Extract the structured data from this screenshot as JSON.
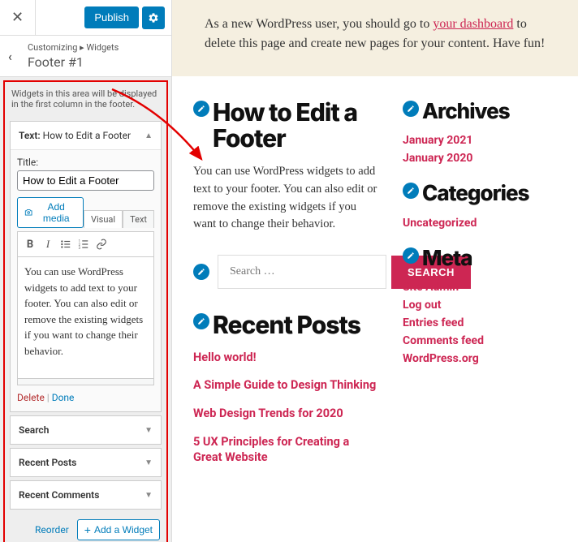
{
  "topbar": {
    "publish": "Publish"
  },
  "breadcrumb": "Customizing ▸ Widgets",
  "panel_title": "Footer #1",
  "panel_desc": "Widgets in this area will be displayed in the first column in the footer.",
  "widget_open": {
    "type_label": "Text:",
    "type_value": "How to Edit a Footer",
    "title_label": "Title:",
    "title_value": "How to Edit a Footer",
    "add_media": "Add media",
    "tabs": {
      "visual": "Visual",
      "text": "Text"
    },
    "content": "You can use WordPress widgets to add text to your footer. You can also edit or remove the existing widgets if you want to change their behavior.",
    "delete": "Delete",
    "done": "Done"
  },
  "widgets_collapsed": [
    "Search",
    "Recent Posts",
    "Recent Comments"
  ],
  "footer_links": {
    "reorder": "Reorder",
    "add_widget": "Add a Widget"
  },
  "preview": {
    "notice_pre": "As a new WordPress user, you should go to ",
    "notice_link": "your dashboard",
    "notice_post": " to delete this page and create new pages for your content. Have fun!",
    "main_title": "How to Edit a Footer",
    "main_text": "You can use WordPress widgets to add text to your footer. You can also edit or remove the existing widgets if you want to change their behavior.",
    "search_placeholder": "Search …",
    "search_btn": "SEARCH",
    "recent_posts_title": "Recent Posts",
    "recent_posts": [
      "Hello world!",
      "A Simple Guide to Design Thinking",
      "Web Design Trends for 2020",
      "5 UX Principles for Creating a Great Website"
    ],
    "archives_title": "Archives",
    "archives": [
      "January 2021",
      "January 2020"
    ],
    "categories_title": "Categories",
    "categories": [
      "Uncategorized"
    ],
    "meta_title": "Meta",
    "meta": [
      "Site Admin",
      "Log out",
      "Entries feed",
      "Comments feed",
      "WordPress.org"
    ]
  }
}
